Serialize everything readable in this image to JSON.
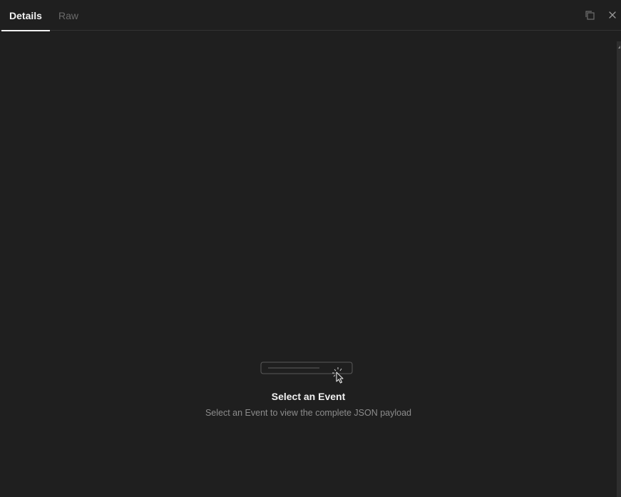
{
  "tabs": [
    {
      "label": "Details",
      "active": true
    },
    {
      "label": "Raw",
      "active": false
    }
  ],
  "toolbar": {
    "copy_icon": "copy-icon",
    "close_icon": "close-icon"
  },
  "empty_state": {
    "title": "Select an Event",
    "description": "Select an Event to view the complete JSON payload",
    "icon": "cursor-click-icon"
  },
  "colors": {
    "background": "#1f1f1f",
    "active_tab": "#f2f2f2",
    "inactive_tab": "#6b6b6b",
    "divider": "#333333",
    "muted_text": "#8c8c8c"
  }
}
